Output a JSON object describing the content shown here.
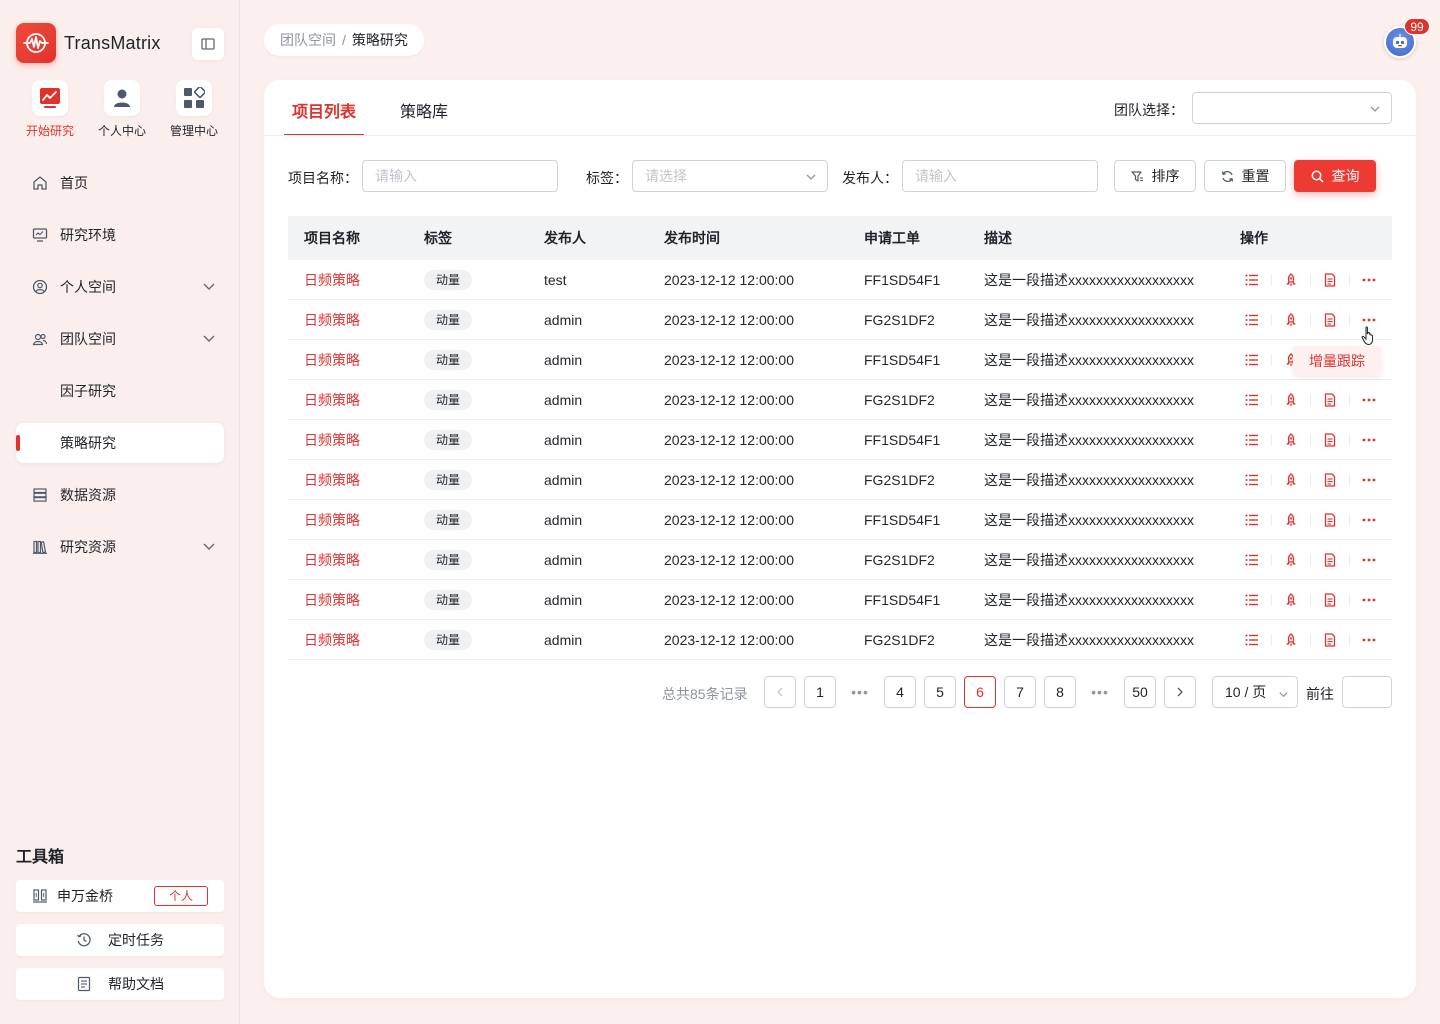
{
  "app": {
    "name": "TransMatrix",
    "brand_color": "#e0322d"
  },
  "quick_nav": [
    {
      "label": "开始研究",
      "icon": "chart-trend-icon",
      "active": true
    },
    {
      "label": "个人中心",
      "icon": "user-icon",
      "active": false
    },
    {
      "label": "管理中心",
      "icon": "grid-apps-icon",
      "active": false
    }
  ],
  "menu": [
    {
      "label": "首页",
      "icon": "home-icon"
    },
    {
      "label": "研究环境",
      "icon": "monitor-icon"
    },
    {
      "label": "个人空间",
      "icon": "user-circle-icon",
      "expandable": true
    },
    {
      "label": "团队空间",
      "icon": "team-icon",
      "expandable": true
    },
    {
      "label": "因子研究",
      "sub": true
    },
    {
      "label": "策略研究",
      "sub": true,
      "active": true
    },
    {
      "label": "数据资源",
      "icon": "database-icon"
    },
    {
      "label": "研究资源",
      "icon": "library-icon",
      "expandable": true
    }
  ],
  "toolbox": {
    "title": "工具箱",
    "items": [
      {
        "label": "申万金桥",
        "icon": "bridge-icon",
        "tag": "个人"
      },
      {
        "label": "定时任务",
        "icon": "clock-icon"
      },
      {
        "label": "帮助文档",
        "icon": "document-icon"
      }
    ]
  },
  "breadcrumb": {
    "parent": "团队空间",
    "separator": "/",
    "current": "策略研究"
  },
  "notifications": {
    "count": "99"
  },
  "tabs": [
    {
      "label": "项目列表",
      "active": true
    },
    {
      "label": "策略库",
      "active": false
    }
  ],
  "team_select": {
    "label": "团队选择：",
    "value": ""
  },
  "filters": {
    "name_label": "项目名称：",
    "name_placeholder": "请输入",
    "tag_label": "标签：",
    "tag_placeholder": "请选择",
    "publisher_label": "发布人：",
    "publisher_placeholder": "请输入",
    "sort_button": "排序",
    "reset_button": "重置",
    "search_button": "查询"
  },
  "table": {
    "columns": [
      "项目名称",
      "标签",
      "发布人",
      "发布时间",
      "申请工单",
      "描述",
      "操作"
    ],
    "rows": [
      {
        "name": "日频策略",
        "tag": "动量",
        "publisher": "test",
        "time": "2023-12-12 12:00:00",
        "ticket": "FF1SD54F1",
        "desc": "这是一段描述xxxxxxxxxxxxxxxxxx"
      },
      {
        "name": "日频策略",
        "tag": "动量",
        "publisher": "admin",
        "time": "2023-12-12 12:00:00",
        "ticket": "FG2S1DF2",
        "desc": "这是一段描述xxxxxxxxxxxxxxxxxx"
      },
      {
        "name": "日频策略",
        "tag": "动量",
        "publisher": "admin",
        "time": "2023-12-12 12:00:00",
        "ticket": "FF1SD54F1",
        "desc": "这是一段描述xxxxxxxxxxxxxxxxxx"
      },
      {
        "name": "日频策略",
        "tag": "动量",
        "publisher": "admin",
        "time": "2023-12-12 12:00:00",
        "ticket": "FG2S1DF2",
        "desc": "这是一段描述xxxxxxxxxxxxxxxxxx"
      },
      {
        "name": "日频策略",
        "tag": "动量",
        "publisher": "admin",
        "time": "2023-12-12 12:00:00",
        "ticket": "FF1SD54F1",
        "desc": "这是一段描述xxxxxxxxxxxxxxxxxx"
      },
      {
        "name": "日频策略",
        "tag": "动量",
        "publisher": "admin",
        "time": "2023-12-12 12:00:00",
        "ticket": "FG2S1DF2",
        "desc": "这是一段描述xxxxxxxxxxxxxxxxxx"
      },
      {
        "name": "日频策略",
        "tag": "动量",
        "publisher": "admin",
        "time": "2023-12-12 12:00:00",
        "ticket": "FF1SD54F1",
        "desc": "这是一段描述xxxxxxxxxxxxxxxxxx"
      },
      {
        "name": "日频策略",
        "tag": "动量",
        "publisher": "admin",
        "time": "2023-12-12 12:00:00",
        "ticket": "FG2S1DF2",
        "desc": "这是一段描述xxxxxxxxxxxxxxxxxx"
      },
      {
        "name": "日频策略",
        "tag": "动量",
        "publisher": "admin",
        "time": "2023-12-12 12:00:00",
        "ticket": "FF1SD54F1",
        "desc": "这是一段描述xxxxxxxxxxxxxxxxxx"
      },
      {
        "name": "日频策略",
        "tag": "动量",
        "publisher": "admin",
        "time": "2023-12-12 12:00:00",
        "ticket": "FG2S1DF2",
        "desc": "这是一段描述xxxxxxxxxxxxxxxxxx"
      }
    ],
    "row_actions": [
      "list-icon",
      "rocket-icon",
      "file-icon",
      "more-icon"
    ],
    "popover_menu": {
      "label": "增量跟踪"
    }
  },
  "pagination": {
    "total_text": "总共85条记录",
    "pages": [
      "1",
      "4",
      "5",
      "6",
      "7",
      "8",
      "50"
    ],
    "current": "6",
    "ellipsis": "•••",
    "page_size": "10 / 页",
    "goto_label": "前往",
    "goto_value": ""
  }
}
